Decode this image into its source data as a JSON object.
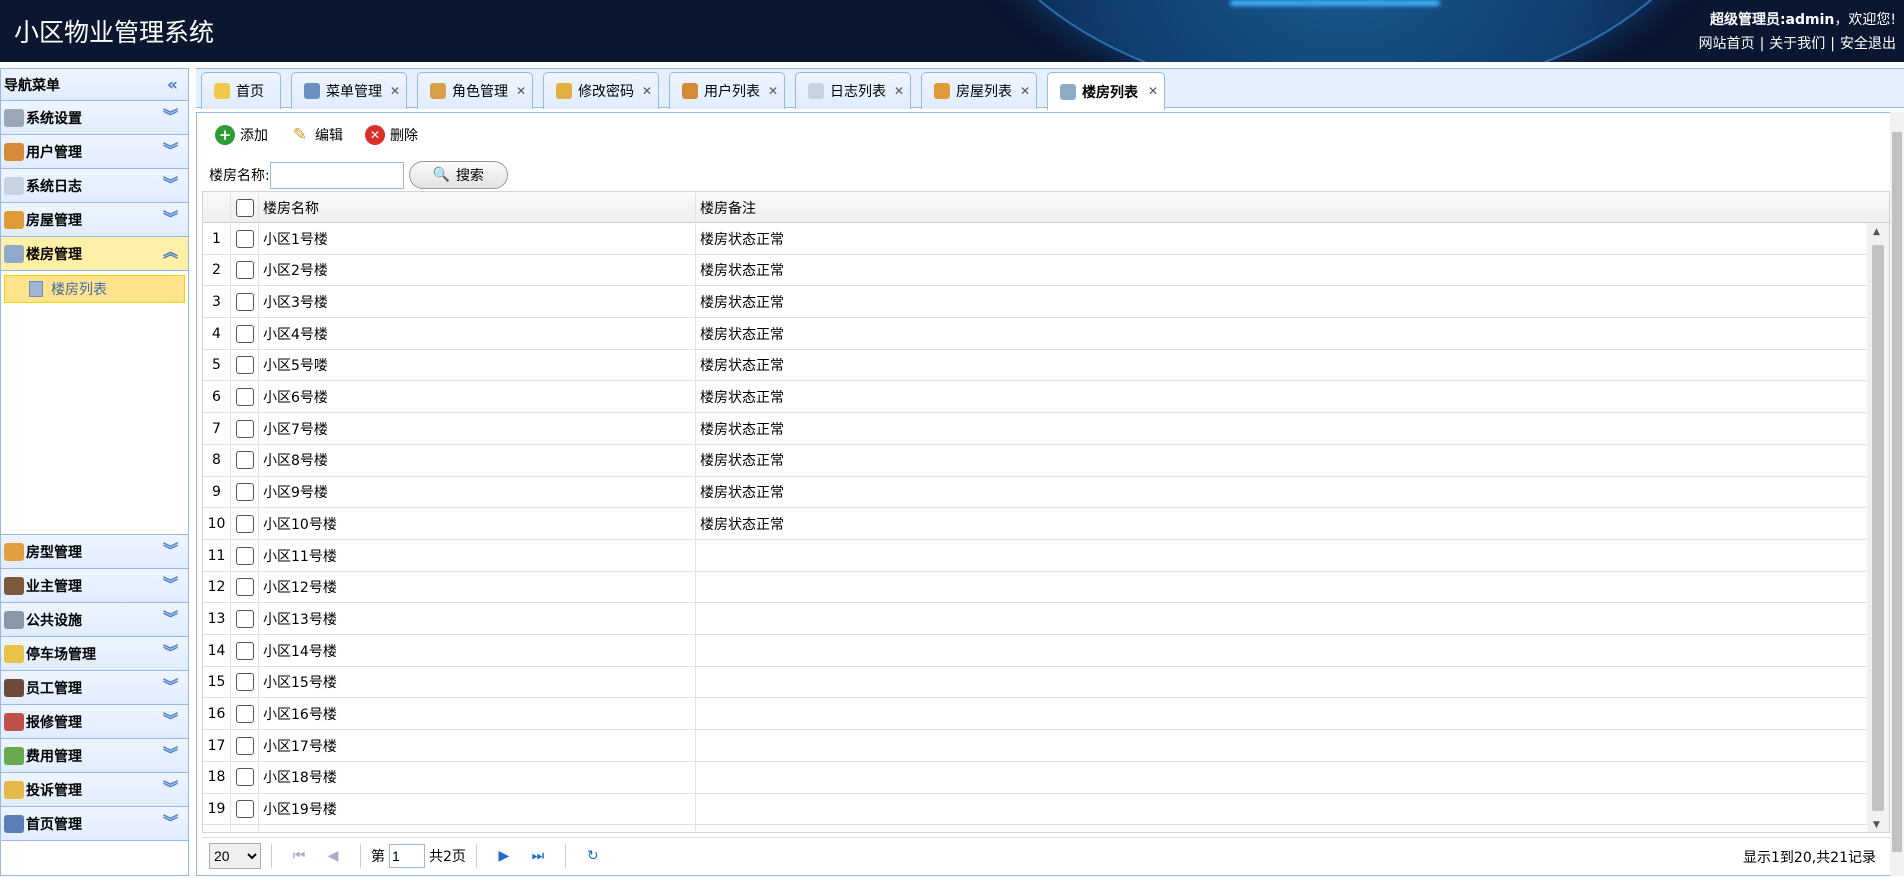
{
  "header": {
    "app_title": "小区物业管理系统",
    "welcome_user": "超级管理员:admin",
    "welcome_suffix": "，欢迎您!",
    "links": [
      "网站首页",
      "关于我们",
      "安全退出"
    ]
  },
  "sidebar": {
    "title": "导航菜单",
    "items_top": [
      {
        "label": "系统设置",
        "icon": "gear-icon",
        "color": "#9aa7b8"
      },
      {
        "label": "用户管理",
        "icon": "users-icon",
        "color": "#d58a3a"
      },
      {
        "label": "系统日志",
        "icon": "log-icon",
        "color": "#c9d3df"
      },
      {
        "label": "房屋管理",
        "icon": "house-icon",
        "color": "#e09a3a"
      },
      {
        "label": "楼房管理",
        "icon": "building-icon",
        "color": "#8fa9c9"
      }
    ],
    "active_sub": {
      "label": "楼房列表",
      "icon": "building-list-icon"
    },
    "items_bottom": [
      {
        "label": "房型管理",
        "icon": "house-type-icon",
        "color": "#e0a040"
      },
      {
        "label": "业主管理",
        "icon": "owner-icon",
        "color": "#7a5a3a"
      },
      {
        "label": "公共设施",
        "icon": "tools-icon",
        "color": "#8898a8"
      },
      {
        "label": "停车场管理",
        "icon": "key-icon",
        "color": "#e6c24a"
      },
      {
        "label": "员工管理",
        "icon": "employee-icon",
        "color": "#6b4a3a"
      },
      {
        "label": "报修管理",
        "icon": "repair-icon",
        "color": "#c0504a"
      },
      {
        "label": "费用管理",
        "icon": "money-icon",
        "color": "#6aa84f"
      },
      {
        "label": "投诉管理",
        "icon": "complaint-icon",
        "color": "#e6b84a"
      },
      {
        "label": "首页管理",
        "icon": "homepage-icon",
        "color": "#5b7fb5"
      }
    ]
  },
  "tabs": [
    {
      "label": "首页",
      "icon": "bulb-icon",
      "color": "#f2c84b",
      "closable": false
    },
    {
      "label": "菜单管理",
      "icon": "menu-tree-icon",
      "color": "#6a8fc0",
      "closable": true
    },
    {
      "label": "角色管理",
      "icon": "role-icon",
      "color": "#d8a04a",
      "closable": true
    },
    {
      "label": "修改密码",
      "icon": "password-icon",
      "color": "#e0b040",
      "closable": true
    },
    {
      "label": "用户列表",
      "icon": "user-list-icon",
      "color": "#d58a3a",
      "closable": true
    },
    {
      "label": "日志列表",
      "icon": "doc-icon",
      "color": "#c9d3df",
      "closable": true
    },
    {
      "label": "房屋列表",
      "icon": "house-list-icon",
      "color": "#e09a3a",
      "closable": true
    },
    {
      "label": "楼房列表",
      "icon": "building-list-icon",
      "color": "#8fa9c9",
      "closable": true,
      "active": true
    }
  ],
  "toolbar": {
    "add": "添加",
    "edit": "编辑",
    "delete": "删除"
  },
  "search": {
    "label": "楼房名称:",
    "value": "",
    "button": "搜索"
  },
  "table": {
    "columns": [
      "楼房名称",
      "楼房备注"
    ],
    "rows": [
      [
        "小区1号楼",
        "楼房状态正常"
      ],
      [
        "小区2号楼",
        "楼房状态正常"
      ],
      [
        "小区3号楼",
        "楼房状态正常"
      ],
      [
        "小区4号楼",
        "楼房状态正常"
      ],
      [
        "小区5号喽",
        "楼房状态正常"
      ],
      [
        "小区6号楼",
        "楼房状态正常"
      ],
      [
        "小区7号楼",
        "楼房状态正常"
      ],
      [
        "小区8号楼",
        "楼房状态正常"
      ],
      [
        "小区9号楼",
        "楼房状态正常"
      ],
      [
        "小区10号楼",
        "楼房状态正常"
      ],
      [
        "小区11号楼",
        ""
      ],
      [
        "小区12号楼",
        ""
      ],
      [
        "小区13号楼",
        ""
      ],
      [
        "小区14号楼",
        ""
      ],
      [
        "小区15号楼",
        ""
      ],
      [
        "小区16号楼",
        ""
      ],
      [
        "小区17号楼",
        ""
      ],
      [
        "小区18号楼",
        ""
      ],
      [
        "小区19号楼",
        ""
      ]
    ]
  },
  "pager": {
    "page_size": "20",
    "page_prefix": "第",
    "page_value": "1",
    "page_total": "共2页",
    "info": "显示1到20,共21记录"
  }
}
